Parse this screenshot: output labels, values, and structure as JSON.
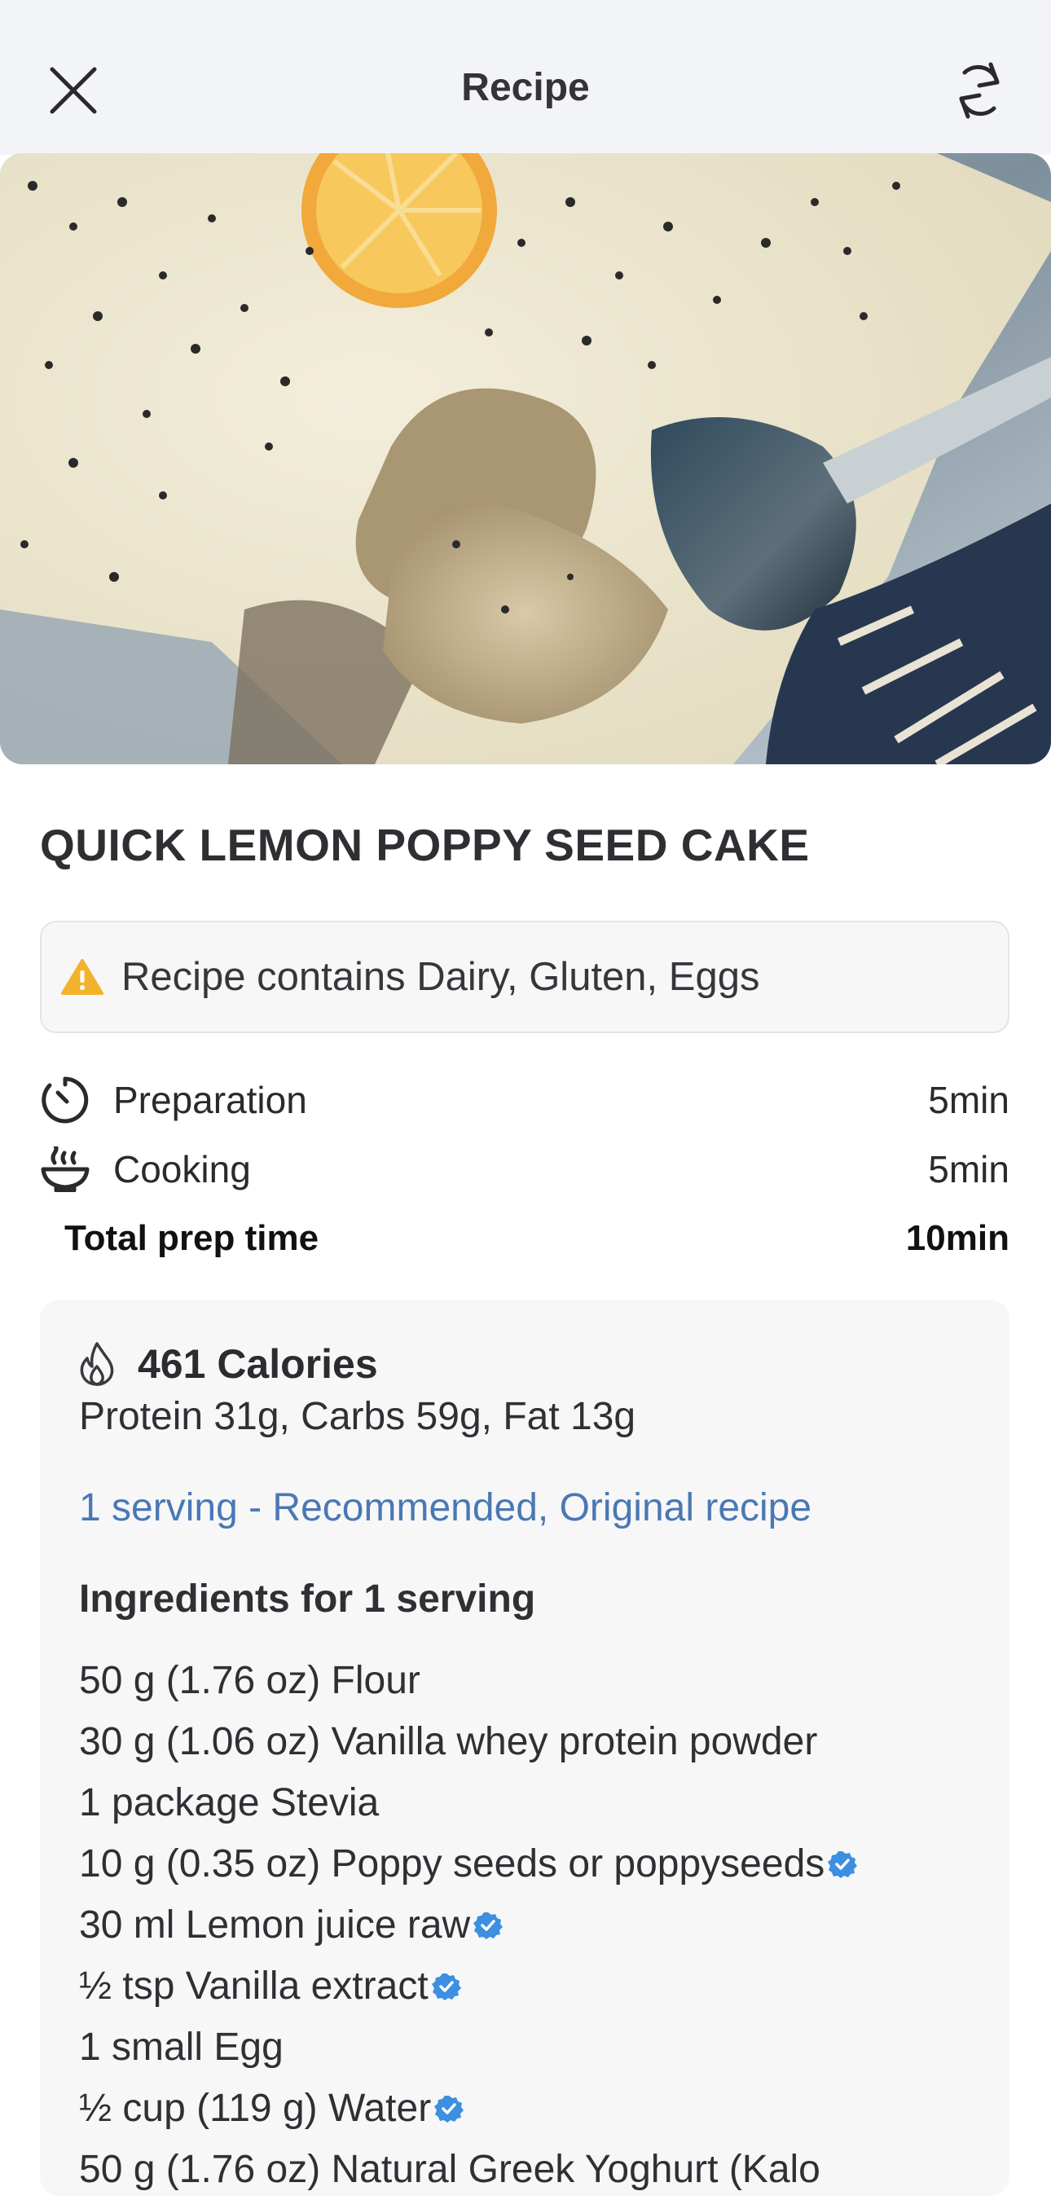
{
  "header": {
    "title": "Recipe",
    "close_icon": "close-icon",
    "sync_icon": "sync-icon"
  },
  "hero": {
    "alt": "Lemon poppy seed cake with spoon"
  },
  "recipe": {
    "title": "QUICK LEMON POPPY SEED CAKE",
    "allergen_text": "Recipe contains Dairy, Gluten, Eggs"
  },
  "times": {
    "preparation": {
      "label": "Preparation",
      "value": "5min"
    },
    "cooking": {
      "label": "Cooking",
      "value": "5min"
    },
    "total": {
      "label": "Total prep time",
      "value": "10min"
    }
  },
  "nutrition": {
    "calories": "461 Calories",
    "macros": "Protein 31g, Carbs 59g, Fat 13g",
    "serving_link": "1 serving - Recommended, Original recipe",
    "ingredients_heading": "Ingredients for 1 serving",
    "ingredients": [
      {
        "text": "50 g (1.76 oz) Flour",
        "verified": false
      },
      {
        "text": "30 g (1.06 oz) Vanilla whey protein powder",
        "verified": false
      },
      {
        "text": "1 package Stevia",
        "verified": false
      },
      {
        "text": "10 g (0.35 oz) Poppy seeds or poppyseeds",
        "verified": true
      },
      {
        "text": "30 ml Lemon juice raw",
        "verified": true
      },
      {
        "text": "½ tsp Vanilla extract",
        "verified": true
      },
      {
        "text": "1 small Egg",
        "verified": false
      },
      {
        "text": "½ cup (119 g) Water",
        "verified": true
      },
      {
        "text": "50 g (1.76 oz) Natural Greek Yoghurt (Kalo",
        "verified": false
      }
    ]
  },
  "colors": {
    "link": "#4a78b4",
    "verified": "#3d8fe0",
    "warning": "#f2b22e",
    "topbar_bg": "#f3f4f8",
    "card_bg": "#f7f7f8"
  }
}
